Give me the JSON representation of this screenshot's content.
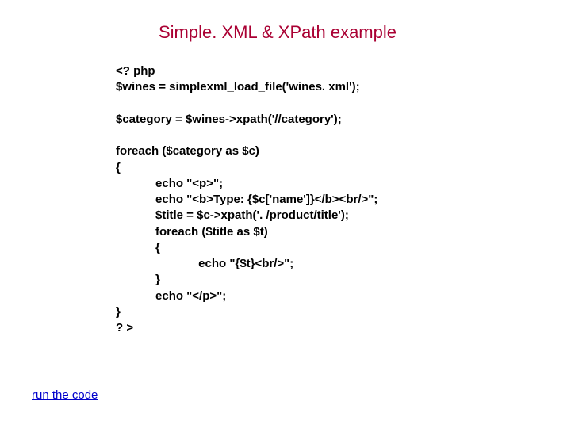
{
  "title": "Simple. XML & XPath example",
  "code": {
    "l1": "<? php",
    "l2": "$wines = simplexml_load_file('wines. xml');",
    "l3": "",
    "l4": "$category = $wines->xpath('//category');",
    "l5": "",
    "l6": "foreach ($category as $c)",
    "l7": "{",
    "l8": "            echo \"<p>\";",
    "l9": "            echo \"<b>Type: {$c['name']}</b><br/>\";",
    "l10": "            $title = $c->xpath('. /product/title');",
    "l11": "            foreach ($title as $t)",
    "l12": "            {",
    "l13": "                         echo \"{$t}<br/>\";",
    "l14": "            }",
    "l15": "            echo \"</p>\";",
    "l16": "}",
    "l17": "? >"
  },
  "run_label": "run the code"
}
